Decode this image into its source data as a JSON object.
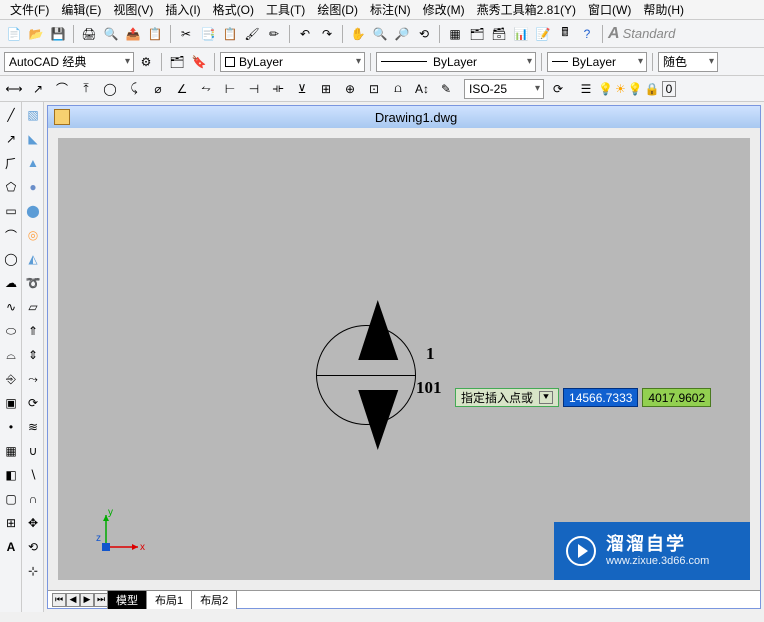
{
  "menu": {
    "file": "文件(F)",
    "edit": "编辑(E)",
    "view": "视图(V)",
    "insert": "插入(I)",
    "format": "格式(O)",
    "tools": "工具(T)",
    "draw": "绘图(D)",
    "dim": "标注(N)",
    "modify": "修改(M)",
    "yx": "燕秀工具箱2.81(Y)",
    "window": "窗口(W)",
    "help": "帮助(H)"
  },
  "style_label": "Standard",
  "workspace_dd": "AutoCAD 经典",
  "layer_name": "ByLayer",
  "linetype_name": "ByLayer",
  "ltcolor_name": "ByLayer",
  "color_dd": "随色",
  "dimstyle": "ISO-25",
  "doc_title": "Drawing1.dwg",
  "marker": {
    "num": "1",
    "id": "101"
  },
  "prompt": {
    "msg": "指定插入点或",
    "x": "14566.7333",
    "y": "4017.9602"
  },
  "tabs": {
    "model": "模型",
    "layout1": "布局1",
    "layout2": "布局2"
  },
  "watermark": {
    "big": "溜溜自学",
    "small": "www.zixue.3d66.com"
  }
}
